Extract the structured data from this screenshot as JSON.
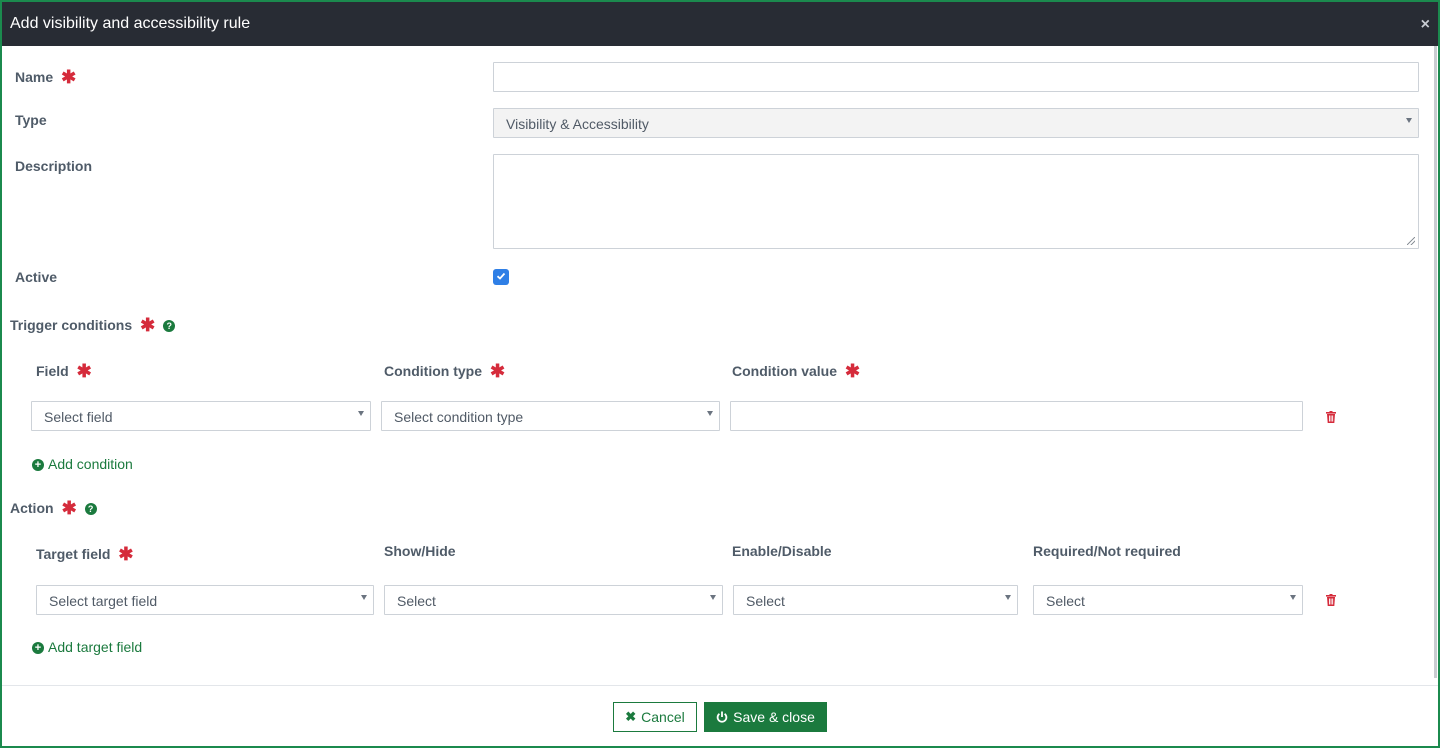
{
  "dialog": {
    "title": "Add visibility and accessibility rule",
    "close_glyph": "×"
  },
  "form": {
    "name_label": "Name",
    "name_value": "",
    "type_label": "Type",
    "type_value": "Visibility & Accessibility",
    "description_label": "Description",
    "description_value": "",
    "active_label": "Active",
    "active_checked": true,
    "required_marker": "✱"
  },
  "trigger": {
    "section_label": "Trigger conditions",
    "columns": {
      "field": "Field",
      "condition_type": "Condition type",
      "condition_value": "Condition value"
    },
    "row": {
      "field_placeholder": "Select field",
      "condition_type_placeholder": "Select condition type",
      "condition_value": ""
    },
    "add_label": "Add condition"
  },
  "action": {
    "section_label": "Action",
    "columns": {
      "target_field": "Target field",
      "show_hide": "Show/Hide",
      "enable_disable": "Enable/Disable",
      "required": "Required/Not required"
    },
    "row": {
      "target_field_placeholder": "Select target field",
      "show_hide_value": "Select",
      "enable_disable_value": "Select",
      "required_value": "Select"
    },
    "add_label": "Add target field"
  },
  "footer": {
    "cancel_label": "Cancel",
    "save_label": "Save & close"
  },
  "colors": {
    "header_bg": "#282c34",
    "accent_green": "#1b7a3e",
    "required_red": "#d52b3b",
    "checkbox_blue": "#2f7fe6"
  },
  "icons": {
    "close": "close-icon",
    "help": "question-circle-icon",
    "add": "plus-circle-icon",
    "delete": "trash-icon",
    "cancel": "x-icon",
    "save": "power-icon",
    "checkbox": "check-icon"
  }
}
